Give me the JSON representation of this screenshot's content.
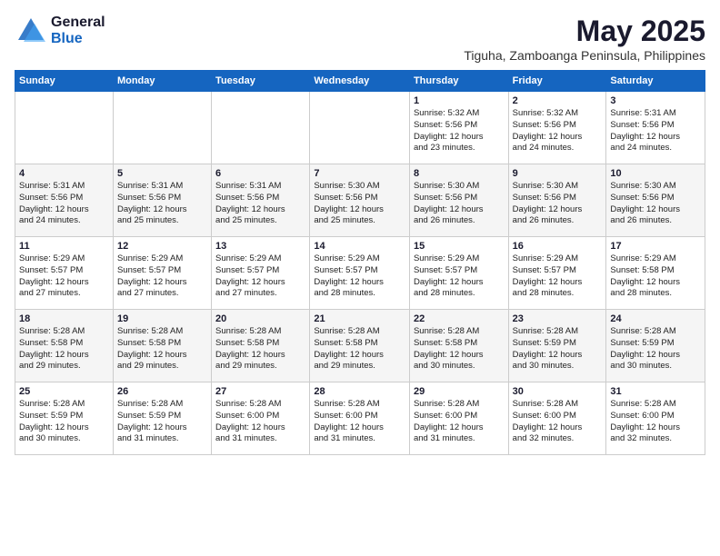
{
  "header": {
    "logo_general": "General",
    "logo_blue": "Blue",
    "month_year": "May 2025",
    "location": "Tiguha, Zamboanga Peninsula, Philippines"
  },
  "days_of_week": [
    "Sunday",
    "Monday",
    "Tuesday",
    "Wednesday",
    "Thursday",
    "Friday",
    "Saturday"
  ],
  "weeks": [
    [
      {
        "day": "",
        "info": ""
      },
      {
        "day": "",
        "info": ""
      },
      {
        "day": "",
        "info": ""
      },
      {
        "day": "",
        "info": ""
      },
      {
        "day": "1",
        "info": "Sunrise: 5:32 AM\nSunset: 5:56 PM\nDaylight: 12 hours\nand 23 minutes."
      },
      {
        "day": "2",
        "info": "Sunrise: 5:32 AM\nSunset: 5:56 PM\nDaylight: 12 hours\nand 24 minutes."
      },
      {
        "day": "3",
        "info": "Sunrise: 5:31 AM\nSunset: 5:56 PM\nDaylight: 12 hours\nand 24 minutes."
      }
    ],
    [
      {
        "day": "4",
        "info": "Sunrise: 5:31 AM\nSunset: 5:56 PM\nDaylight: 12 hours\nand 24 minutes."
      },
      {
        "day": "5",
        "info": "Sunrise: 5:31 AM\nSunset: 5:56 PM\nDaylight: 12 hours\nand 25 minutes."
      },
      {
        "day": "6",
        "info": "Sunrise: 5:31 AM\nSunset: 5:56 PM\nDaylight: 12 hours\nand 25 minutes."
      },
      {
        "day": "7",
        "info": "Sunrise: 5:30 AM\nSunset: 5:56 PM\nDaylight: 12 hours\nand 25 minutes."
      },
      {
        "day": "8",
        "info": "Sunrise: 5:30 AM\nSunset: 5:56 PM\nDaylight: 12 hours\nand 26 minutes."
      },
      {
        "day": "9",
        "info": "Sunrise: 5:30 AM\nSunset: 5:56 PM\nDaylight: 12 hours\nand 26 minutes."
      },
      {
        "day": "10",
        "info": "Sunrise: 5:30 AM\nSunset: 5:56 PM\nDaylight: 12 hours\nand 26 minutes."
      }
    ],
    [
      {
        "day": "11",
        "info": "Sunrise: 5:29 AM\nSunset: 5:57 PM\nDaylight: 12 hours\nand 27 minutes."
      },
      {
        "day": "12",
        "info": "Sunrise: 5:29 AM\nSunset: 5:57 PM\nDaylight: 12 hours\nand 27 minutes."
      },
      {
        "day": "13",
        "info": "Sunrise: 5:29 AM\nSunset: 5:57 PM\nDaylight: 12 hours\nand 27 minutes."
      },
      {
        "day": "14",
        "info": "Sunrise: 5:29 AM\nSunset: 5:57 PM\nDaylight: 12 hours\nand 28 minutes."
      },
      {
        "day": "15",
        "info": "Sunrise: 5:29 AM\nSunset: 5:57 PM\nDaylight: 12 hours\nand 28 minutes."
      },
      {
        "day": "16",
        "info": "Sunrise: 5:29 AM\nSunset: 5:57 PM\nDaylight: 12 hours\nand 28 minutes."
      },
      {
        "day": "17",
        "info": "Sunrise: 5:29 AM\nSunset: 5:58 PM\nDaylight: 12 hours\nand 28 minutes."
      }
    ],
    [
      {
        "day": "18",
        "info": "Sunrise: 5:28 AM\nSunset: 5:58 PM\nDaylight: 12 hours\nand 29 minutes."
      },
      {
        "day": "19",
        "info": "Sunrise: 5:28 AM\nSunset: 5:58 PM\nDaylight: 12 hours\nand 29 minutes."
      },
      {
        "day": "20",
        "info": "Sunrise: 5:28 AM\nSunset: 5:58 PM\nDaylight: 12 hours\nand 29 minutes."
      },
      {
        "day": "21",
        "info": "Sunrise: 5:28 AM\nSunset: 5:58 PM\nDaylight: 12 hours\nand 29 minutes."
      },
      {
        "day": "22",
        "info": "Sunrise: 5:28 AM\nSunset: 5:58 PM\nDaylight: 12 hours\nand 30 minutes."
      },
      {
        "day": "23",
        "info": "Sunrise: 5:28 AM\nSunset: 5:59 PM\nDaylight: 12 hours\nand 30 minutes."
      },
      {
        "day": "24",
        "info": "Sunrise: 5:28 AM\nSunset: 5:59 PM\nDaylight: 12 hours\nand 30 minutes."
      }
    ],
    [
      {
        "day": "25",
        "info": "Sunrise: 5:28 AM\nSunset: 5:59 PM\nDaylight: 12 hours\nand 30 minutes."
      },
      {
        "day": "26",
        "info": "Sunrise: 5:28 AM\nSunset: 5:59 PM\nDaylight: 12 hours\nand 31 minutes."
      },
      {
        "day": "27",
        "info": "Sunrise: 5:28 AM\nSunset: 6:00 PM\nDaylight: 12 hours\nand 31 minutes."
      },
      {
        "day": "28",
        "info": "Sunrise: 5:28 AM\nSunset: 6:00 PM\nDaylight: 12 hours\nand 31 minutes."
      },
      {
        "day": "29",
        "info": "Sunrise: 5:28 AM\nSunset: 6:00 PM\nDaylight: 12 hours\nand 31 minutes."
      },
      {
        "day": "30",
        "info": "Sunrise: 5:28 AM\nSunset: 6:00 PM\nDaylight: 12 hours\nand 32 minutes."
      },
      {
        "day": "31",
        "info": "Sunrise: 5:28 AM\nSunset: 6:00 PM\nDaylight: 12 hours\nand 32 minutes."
      }
    ]
  ]
}
